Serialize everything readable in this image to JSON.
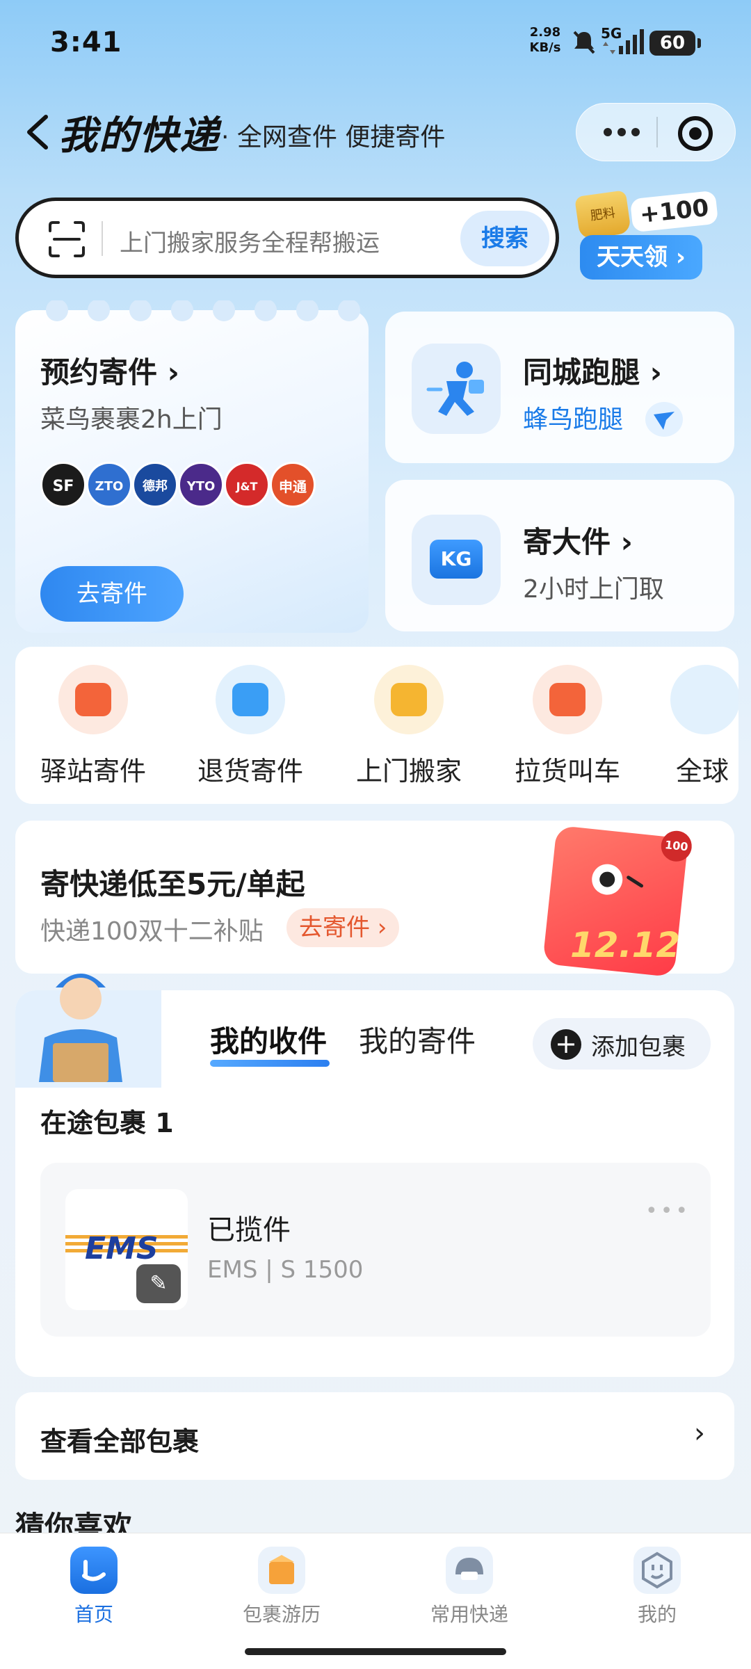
{
  "status_bar": {
    "time": "3:41",
    "net_speed_value": "2.98",
    "net_speed_unit": "KB/s",
    "network": "5G",
    "battery": "60"
  },
  "header": {
    "title": "我的快递",
    "subtitle": "· 全网查件 便捷寄件"
  },
  "search": {
    "placeholder": "上门搬家服务全程帮搬运",
    "button": "搜索"
  },
  "promo": {
    "bag_label": "肥料",
    "points": "+100",
    "label": "天天领 ›"
  },
  "cards": {
    "book": {
      "title": "预约寄件 ›",
      "desc": "菜鸟裹裹2h上门",
      "button": "去寄件",
      "logos": [
        "SF",
        "ZTO",
        "德邦",
        "YTO",
        "J&T",
        "申通"
      ]
    },
    "run": {
      "title": "同城跑腿 ›",
      "sub": "蜂鸟跑腿"
    },
    "big": {
      "title": "寄大件 ›",
      "sub": "2小时上门取",
      "icon_text": "KG"
    }
  },
  "services": [
    {
      "label": "驿站寄件",
      "color": "#f3643a",
      "bg": "#fde9e0"
    },
    {
      "label": "退货寄件",
      "color": "#3a9ef5",
      "bg": "#e2f1fd"
    },
    {
      "label": "上门搬家",
      "color": "#f5b531",
      "bg": "#fdf1d9"
    },
    {
      "label": "拉货叫车",
      "color": "#f3643a",
      "bg": "#fde9e0"
    },
    {
      "label": "全球",
      "color": "#3a9ef5",
      "bg": "#e2f1fd"
    }
  ],
  "banner": {
    "title": "寄快递低至5元/单起",
    "sub": "快递100双十二补贴",
    "button": "去寄件 ›",
    "gift_text": "12.12",
    "gift_badge": "100"
  },
  "packages": {
    "tabs": [
      "我的收件",
      "我的寄件"
    ],
    "add_label": "添加包裹",
    "transit_title": "在途包裹 1",
    "item": {
      "carrier_logo": "EMS",
      "status": "已揽件",
      "info": "EMS | S          1500"
    }
  },
  "view_all": {
    "label": "查看全部包裹",
    "arrow": "›"
  },
  "guess_title": "猜你喜欢",
  "tabbar": [
    {
      "label": "首页",
      "active": true
    },
    {
      "label": "包裹游历",
      "active": false
    },
    {
      "label": "常用快递",
      "active": false
    },
    {
      "label": "我的",
      "active": false
    }
  ],
  "colors": {
    "accent": "#1a7be8",
    "active_tab": "#1a6fe0"
  }
}
